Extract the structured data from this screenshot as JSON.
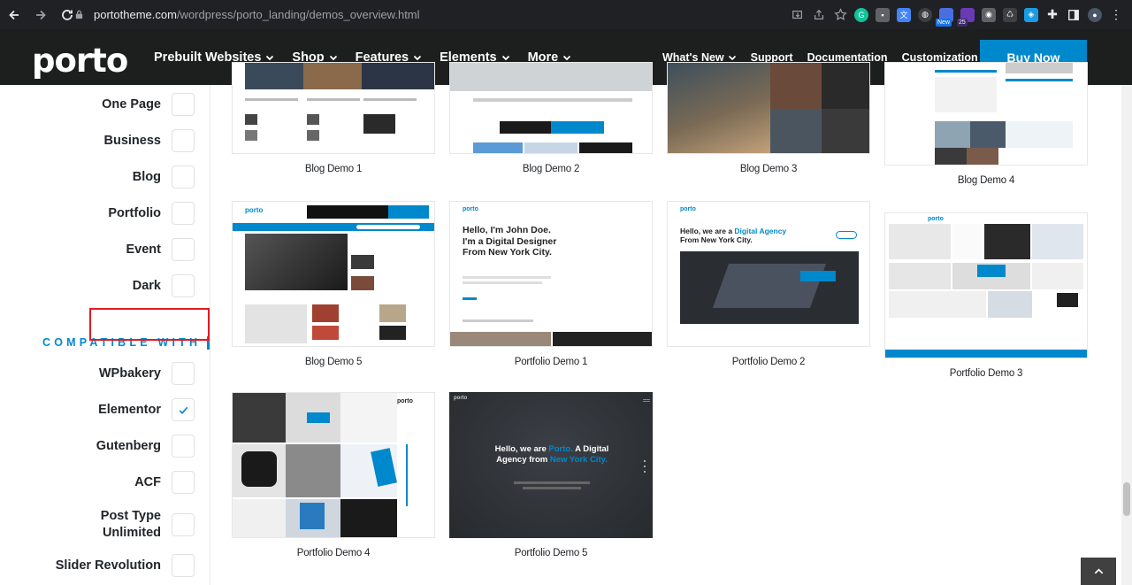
{
  "browser": {
    "url_host": "portotheme.com",
    "url_path": "/wordpress/porto_landing/demos_overview.html",
    "ext_badge": "New",
    "ext_count": "25"
  },
  "site": {
    "logo": "porto",
    "main_nav": [
      "Prebuilt Websites",
      "Shop",
      "Features",
      "Elements",
      "More"
    ],
    "secondary_nav": [
      "What's New",
      "Support",
      "Documentation",
      "Customization"
    ],
    "buy_button": "Buy Now"
  },
  "sidebar": {
    "type_filters": [
      {
        "label": "One Page",
        "checked": false
      },
      {
        "label": "Business",
        "checked": false
      },
      {
        "label": "Blog",
        "checked": false
      },
      {
        "label": "Portfolio",
        "checked": false
      },
      {
        "label": "Event",
        "checked": false
      },
      {
        "label": "Dark",
        "checked": false
      }
    ],
    "compatible_heading": "COMPATIBLE WITH",
    "compat_filters": [
      {
        "label": "WPbakery",
        "checked": false
      },
      {
        "label": "Elementor",
        "checked": true
      },
      {
        "label": "Gutenberg",
        "checked": false
      },
      {
        "label": "ACF",
        "checked": false
      },
      {
        "label": "Post Type Unlimited",
        "checked": false
      },
      {
        "label": "Slider Revolution",
        "checked": false
      }
    ]
  },
  "demos": [
    {
      "title": "Blog Demo 1"
    },
    {
      "title": "Blog Demo 2"
    },
    {
      "title": "Blog Demo 3"
    },
    {
      "title": "Blog Demo 4"
    },
    {
      "title": "Blog Demo 5"
    },
    {
      "title": "Portfolio Demo 1"
    },
    {
      "title": "Portfolio Demo 2"
    },
    {
      "title": "Portfolio Demo 3"
    },
    {
      "title": "Portfolio Demo 4"
    },
    {
      "title": "Portfolio Demo 5"
    }
  ],
  "thumb_text": {
    "p1_heading": "Hello, I'm John Doe. I'm a Digital Designer From New York City.",
    "p2_heading_a": "Hello, we are a ",
    "p2_heading_b": "Digital Agency",
    "p2_heading_c": "From New York City.",
    "p5_heading_a": "Hello, we are ",
    "p5_heading_b": "Porto.",
    "p5_heading_c": " A Digital Agency from ",
    "p5_heading_d": "New York City.",
    "thumb_logo": "porto"
  },
  "colors": {
    "accent": "#0088cc",
    "header_bg": "#1d1f1e",
    "highlight": "#e31b23"
  }
}
